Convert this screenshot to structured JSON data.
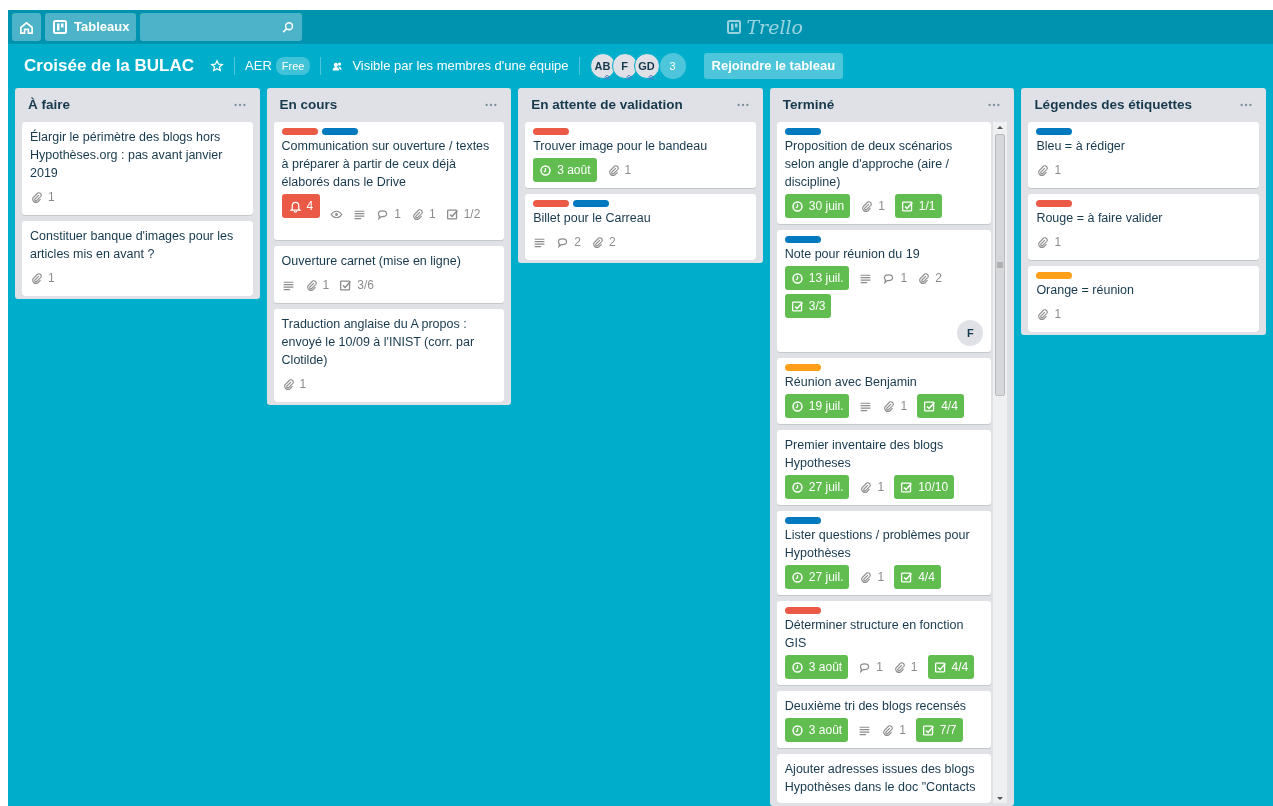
{
  "topbar": {
    "tableaux": "Tableaux",
    "logo": "Trello"
  },
  "board": {
    "title": "Croisée de la BULAC",
    "starred": false,
    "team": "AER",
    "plan": "Free",
    "visibility": "Visible par les membres d'une équipe",
    "members": [
      "AB",
      "F",
      "GD"
    ],
    "more_members": "3",
    "join": "Rejoindre le tableau"
  },
  "lists": [
    {
      "title": "À faire",
      "scrollable": false,
      "cards": [
        {
          "title": "Élargir le périmètre des blogs hors Hypothèses.org : pas avant janvier 2019",
          "badges": [
            {
              "kind": "attachments",
              "text": "1"
            }
          ]
        },
        {
          "title": "Constituer banque d'images pour les articles mis en avant ?",
          "badges": [
            {
              "kind": "attachments",
              "text": "1"
            }
          ]
        }
      ]
    },
    {
      "title": "En cours",
      "scrollable": false,
      "cards": [
        {
          "labels": [
            {
              "color": "#eb5a46"
            },
            {
              "color": "#0079bf"
            }
          ],
          "title": "Communication sur ouverture / textes à préparer à partir de ceux déjà élaborés dans le Drive",
          "badges": [
            {
              "kind": "notifications",
              "text": "4"
            },
            {
              "kind": "watch"
            },
            {
              "kind": "description"
            },
            {
              "kind": "comments",
              "text": "1"
            },
            {
              "kind": "attachments",
              "text": "1"
            },
            {
              "kind": "checklist",
              "text": "1/2",
              "complete": false
            }
          ]
        },
        {
          "title": "Ouverture carnet (mise en ligne)",
          "badges": [
            {
              "kind": "description"
            },
            {
              "kind": "attachments",
              "text": "1"
            },
            {
              "kind": "checklist",
              "text": "3/6",
              "complete": false
            }
          ]
        },
        {
          "title": "Traduction anglaise du A propos : envoyé le 10/09 à l'INIST (corr. par Clotilde)",
          "badges": [
            {
              "kind": "attachments",
              "text": "1"
            }
          ]
        }
      ]
    },
    {
      "title": "En attente de validation",
      "scrollable": false,
      "cards": [
        {
          "labels": [
            {
              "color": "#eb5a46"
            }
          ],
          "title": "Trouver image pour le bandeau",
          "badges": [
            {
              "kind": "due",
              "text": "3 août",
              "complete": true
            },
            {
              "kind": "attachments",
              "text": "1"
            }
          ]
        },
        {
          "labels": [
            {
              "color": "#eb5a46"
            },
            {
              "color": "#0079bf"
            }
          ],
          "title": "Billet pour le Carreau",
          "badges": [
            {
              "kind": "description"
            },
            {
              "kind": "comments",
              "text": "2"
            },
            {
              "kind": "attachments",
              "text": "2"
            }
          ]
        }
      ]
    },
    {
      "title": "Terminé",
      "scrollable": true,
      "cards": [
        {
          "labels": [
            {
              "color": "#0079bf"
            }
          ],
          "title": "Proposition de deux scénarios selon angle d'approche (aire / discipline)",
          "badges": [
            {
              "kind": "due",
              "text": "30 juin",
              "complete": true
            },
            {
              "kind": "attachments",
              "text": "1"
            },
            {
              "kind": "checklist",
              "text": "1/1",
              "complete": true
            }
          ]
        },
        {
          "labels": [
            {
              "color": "#0079bf"
            }
          ],
          "title": "Note pour réunion du 19",
          "badges": [
            {
              "kind": "due",
              "text": "13 juil.",
              "complete": true
            },
            {
              "kind": "description"
            },
            {
              "kind": "comments",
              "text": "1"
            },
            {
              "kind": "attachments",
              "text": "2"
            },
            {
              "kind": "checklist",
              "text": "3/3",
              "complete": true
            }
          ],
          "members": [
            "F"
          ]
        },
        {
          "labels": [
            {
              "color": "#ff9f1a"
            }
          ],
          "title": "Réunion avec Benjamin",
          "badges": [
            {
              "kind": "due",
              "text": "19 juil.",
              "complete": true
            },
            {
              "kind": "description"
            },
            {
              "kind": "attachments",
              "text": "1"
            },
            {
              "kind": "checklist",
              "text": "4/4",
              "complete": true
            }
          ]
        },
        {
          "title": "Premier inventaire des blogs Hypotheses",
          "badges": [
            {
              "kind": "due",
              "text": "27 juil.",
              "complete": true
            },
            {
              "kind": "attachments",
              "text": "1"
            },
            {
              "kind": "checklist",
              "text": "10/10",
              "complete": true
            }
          ]
        },
        {
          "labels": [
            {
              "color": "#0079bf"
            }
          ],
          "title": "Lister questions / problèmes pour Hypothèses",
          "badges": [
            {
              "kind": "due",
              "text": "27 juil.",
              "complete": true
            },
            {
              "kind": "attachments",
              "text": "1"
            },
            {
              "kind": "checklist",
              "text": "4/4",
              "complete": true
            }
          ]
        },
        {
          "labels": [
            {
              "color": "#eb5a46"
            }
          ],
          "title": "Déterminer structure en fonction GIS",
          "badges": [
            {
              "kind": "due",
              "text": "3 août",
              "complete": true
            },
            {
              "kind": "comments",
              "text": "1"
            },
            {
              "kind": "attachments",
              "text": "1"
            },
            {
              "kind": "checklist",
              "text": "4/4",
              "complete": true
            }
          ]
        },
        {
          "title": "Deuxième tri des blogs recensés",
          "badges": [
            {
              "kind": "due",
              "text": "3 août",
              "complete": true
            },
            {
              "kind": "description"
            },
            {
              "kind": "attachments",
              "text": "1"
            },
            {
              "kind": "checklist",
              "text": "7/7",
              "complete": true
            }
          ]
        },
        {
          "title": "Ajouter adresses issues des blogs Hypothèses dans le doc \"Contacts"
        }
      ]
    },
    {
      "title": "Légendes des étiquettes",
      "scrollable": false,
      "cards": [
        {
          "labels": [
            {
              "color": "#0079bf"
            }
          ],
          "title": "Bleu = à rédiger",
          "badges": [
            {
              "kind": "attachments",
              "text": "1"
            }
          ]
        },
        {
          "labels": [
            {
              "color": "#eb5a46"
            }
          ],
          "title": "Rouge = à faire valider",
          "badges": [
            {
              "kind": "attachments",
              "text": "1"
            }
          ]
        },
        {
          "labels": [
            {
              "color": "#ff9f1a"
            }
          ],
          "title": "Orange = réunion",
          "badges": [
            {
              "kind": "attachments",
              "text": "1"
            }
          ]
        }
      ]
    }
  ]
}
